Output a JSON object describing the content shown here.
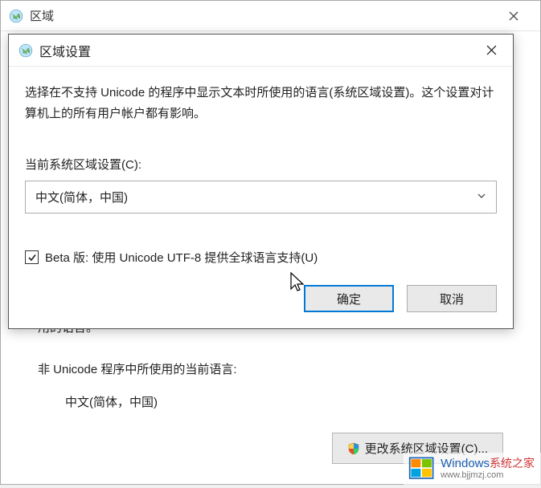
{
  "parent": {
    "title": "区域",
    "partial_line": "用的语言。",
    "non_unicode_label": "非 Unicode 程序中所使用的当前语言:",
    "current_lang": "中文(简体，中国)",
    "change_locale_button": "更改系统区域设置(C)..."
  },
  "dialog": {
    "title": "区域设置",
    "description": "选择在不支持 Unicode 的程序中显示文本时所使用的语言(系统区域设置)。这个设置对计算机上的所有用户帐户都有影响。",
    "current_locale_label": "当前系统区域设置(C):",
    "selected_locale": "中文(简体，中国)",
    "checkbox_label": "Beta 版: 使用 Unicode UTF-8 提供全球语言支持(U)",
    "checkbox_checked": true,
    "ok_label": "确定",
    "cancel_label": "取消"
  },
  "watermark": {
    "brand": "Windows",
    "brand_zh": "系统之家",
    "url": "www.bjjmzj.com"
  }
}
